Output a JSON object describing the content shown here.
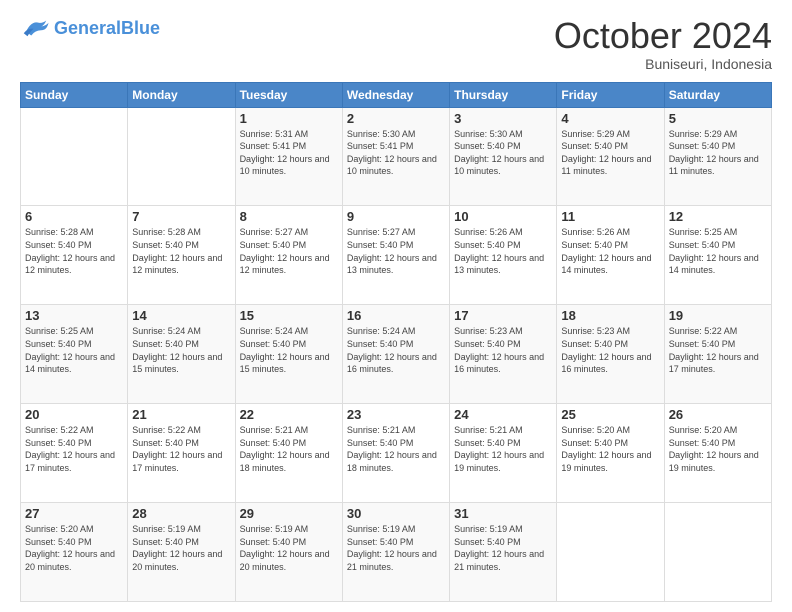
{
  "header": {
    "logo_general": "General",
    "logo_blue": "Blue",
    "month": "October 2024",
    "location": "Buniseuri, Indonesia"
  },
  "weekdays": [
    "Sunday",
    "Monday",
    "Tuesday",
    "Wednesday",
    "Thursday",
    "Friday",
    "Saturday"
  ],
  "weeks": [
    [
      {
        "day": "",
        "info": ""
      },
      {
        "day": "",
        "info": ""
      },
      {
        "day": "1",
        "info": "Sunrise: 5:31 AM\nSunset: 5:41 PM\nDaylight: 12 hours and 10 minutes."
      },
      {
        "day": "2",
        "info": "Sunrise: 5:30 AM\nSunset: 5:41 PM\nDaylight: 12 hours and 10 minutes."
      },
      {
        "day": "3",
        "info": "Sunrise: 5:30 AM\nSunset: 5:40 PM\nDaylight: 12 hours and 10 minutes."
      },
      {
        "day": "4",
        "info": "Sunrise: 5:29 AM\nSunset: 5:40 PM\nDaylight: 12 hours and 11 minutes."
      },
      {
        "day": "5",
        "info": "Sunrise: 5:29 AM\nSunset: 5:40 PM\nDaylight: 12 hours and 11 minutes."
      }
    ],
    [
      {
        "day": "6",
        "info": "Sunrise: 5:28 AM\nSunset: 5:40 PM\nDaylight: 12 hours and 12 minutes."
      },
      {
        "day": "7",
        "info": "Sunrise: 5:28 AM\nSunset: 5:40 PM\nDaylight: 12 hours and 12 minutes."
      },
      {
        "day": "8",
        "info": "Sunrise: 5:27 AM\nSunset: 5:40 PM\nDaylight: 12 hours and 12 minutes."
      },
      {
        "day": "9",
        "info": "Sunrise: 5:27 AM\nSunset: 5:40 PM\nDaylight: 12 hours and 13 minutes."
      },
      {
        "day": "10",
        "info": "Sunrise: 5:26 AM\nSunset: 5:40 PM\nDaylight: 12 hours and 13 minutes."
      },
      {
        "day": "11",
        "info": "Sunrise: 5:26 AM\nSunset: 5:40 PM\nDaylight: 12 hours and 14 minutes."
      },
      {
        "day": "12",
        "info": "Sunrise: 5:25 AM\nSunset: 5:40 PM\nDaylight: 12 hours and 14 minutes."
      }
    ],
    [
      {
        "day": "13",
        "info": "Sunrise: 5:25 AM\nSunset: 5:40 PM\nDaylight: 12 hours and 14 minutes."
      },
      {
        "day": "14",
        "info": "Sunrise: 5:24 AM\nSunset: 5:40 PM\nDaylight: 12 hours and 15 minutes."
      },
      {
        "day": "15",
        "info": "Sunrise: 5:24 AM\nSunset: 5:40 PM\nDaylight: 12 hours and 15 minutes."
      },
      {
        "day": "16",
        "info": "Sunrise: 5:24 AM\nSunset: 5:40 PM\nDaylight: 12 hours and 16 minutes."
      },
      {
        "day": "17",
        "info": "Sunrise: 5:23 AM\nSunset: 5:40 PM\nDaylight: 12 hours and 16 minutes."
      },
      {
        "day": "18",
        "info": "Sunrise: 5:23 AM\nSunset: 5:40 PM\nDaylight: 12 hours and 16 minutes."
      },
      {
        "day": "19",
        "info": "Sunrise: 5:22 AM\nSunset: 5:40 PM\nDaylight: 12 hours and 17 minutes."
      }
    ],
    [
      {
        "day": "20",
        "info": "Sunrise: 5:22 AM\nSunset: 5:40 PM\nDaylight: 12 hours and 17 minutes."
      },
      {
        "day": "21",
        "info": "Sunrise: 5:22 AM\nSunset: 5:40 PM\nDaylight: 12 hours and 17 minutes."
      },
      {
        "day": "22",
        "info": "Sunrise: 5:21 AM\nSunset: 5:40 PM\nDaylight: 12 hours and 18 minutes."
      },
      {
        "day": "23",
        "info": "Sunrise: 5:21 AM\nSunset: 5:40 PM\nDaylight: 12 hours and 18 minutes."
      },
      {
        "day": "24",
        "info": "Sunrise: 5:21 AM\nSunset: 5:40 PM\nDaylight: 12 hours and 19 minutes."
      },
      {
        "day": "25",
        "info": "Sunrise: 5:20 AM\nSunset: 5:40 PM\nDaylight: 12 hours and 19 minutes."
      },
      {
        "day": "26",
        "info": "Sunrise: 5:20 AM\nSunset: 5:40 PM\nDaylight: 12 hours and 19 minutes."
      }
    ],
    [
      {
        "day": "27",
        "info": "Sunrise: 5:20 AM\nSunset: 5:40 PM\nDaylight: 12 hours and 20 minutes."
      },
      {
        "day": "28",
        "info": "Sunrise: 5:19 AM\nSunset: 5:40 PM\nDaylight: 12 hours and 20 minutes."
      },
      {
        "day": "29",
        "info": "Sunrise: 5:19 AM\nSunset: 5:40 PM\nDaylight: 12 hours and 20 minutes."
      },
      {
        "day": "30",
        "info": "Sunrise: 5:19 AM\nSunset: 5:40 PM\nDaylight: 12 hours and 21 minutes."
      },
      {
        "day": "31",
        "info": "Sunrise: 5:19 AM\nSunset: 5:40 PM\nDaylight: 12 hours and 21 minutes."
      },
      {
        "day": "",
        "info": ""
      },
      {
        "day": "",
        "info": ""
      }
    ]
  ]
}
